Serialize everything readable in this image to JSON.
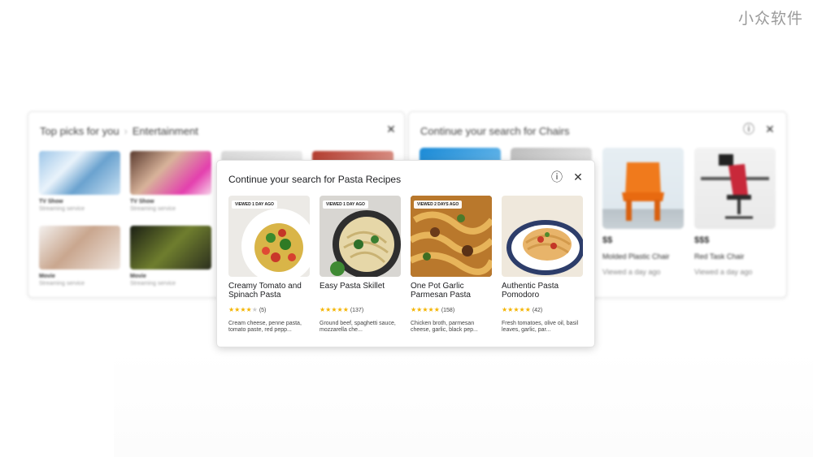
{
  "watermark": "小众软件",
  "entertainment_card": {
    "title": "Top picks for you",
    "category": "Entertainment",
    "close_icon": "close-icon",
    "tiles": [
      {
        "type": "TV Show",
        "subtitle": "Streaming service"
      },
      {
        "type": "TV Show",
        "subtitle": "Streaming service"
      },
      {
        "type": "Movie",
        "subtitle": "Streaming service"
      },
      {
        "type": "Movie",
        "subtitle": "Streaming service"
      }
    ]
  },
  "chairs_card": {
    "title": "Continue your search for Chairs",
    "info_icon": "info-icon",
    "close_icon": "close-icon",
    "items": [
      {
        "price": "$$",
        "name": "Molded Plastic Chair",
        "viewed": "Viewed a day ago"
      },
      {
        "price": "$$$",
        "name": "Red Task Chair",
        "viewed": "Viewed a day ago"
      }
    ]
  },
  "pasta_card": {
    "title": "Continue your search for Pasta Recipes",
    "info_icon": "info-icon",
    "close_icon": "close-icon",
    "recipes": [
      {
        "badge": "VIEWED 1 DAY AGO",
        "name": "Creamy Tomato and Spinach Pasta",
        "rating": 4,
        "count": "(5)",
        "ingredients": "Cream cheese, penne pasta, tomato paste, red pepp..."
      },
      {
        "badge": "VIEWED 1 DAY AGO",
        "name": "Easy Pasta Skillet",
        "rating": 5,
        "count": "(137)",
        "ingredients": "Ground beef, spaghetti sauce, mozzarella che..."
      },
      {
        "badge": "VIEWED 2 DAYS AGO",
        "name": "One Pot Garlic Parmesan Pasta",
        "rating": 5,
        "count": "(158)",
        "ingredients": "Chicken broth, parmesan cheese, garlic, black pep..."
      },
      {
        "badge": "",
        "name": "Authentic Pasta Pomodoro",
        "rating": 5,
        "count": "(42)",
        "ingredients": "Fresh tomatoes, olive oil, basil leaves, garlic, par..."
      }
    ]
  }
}
